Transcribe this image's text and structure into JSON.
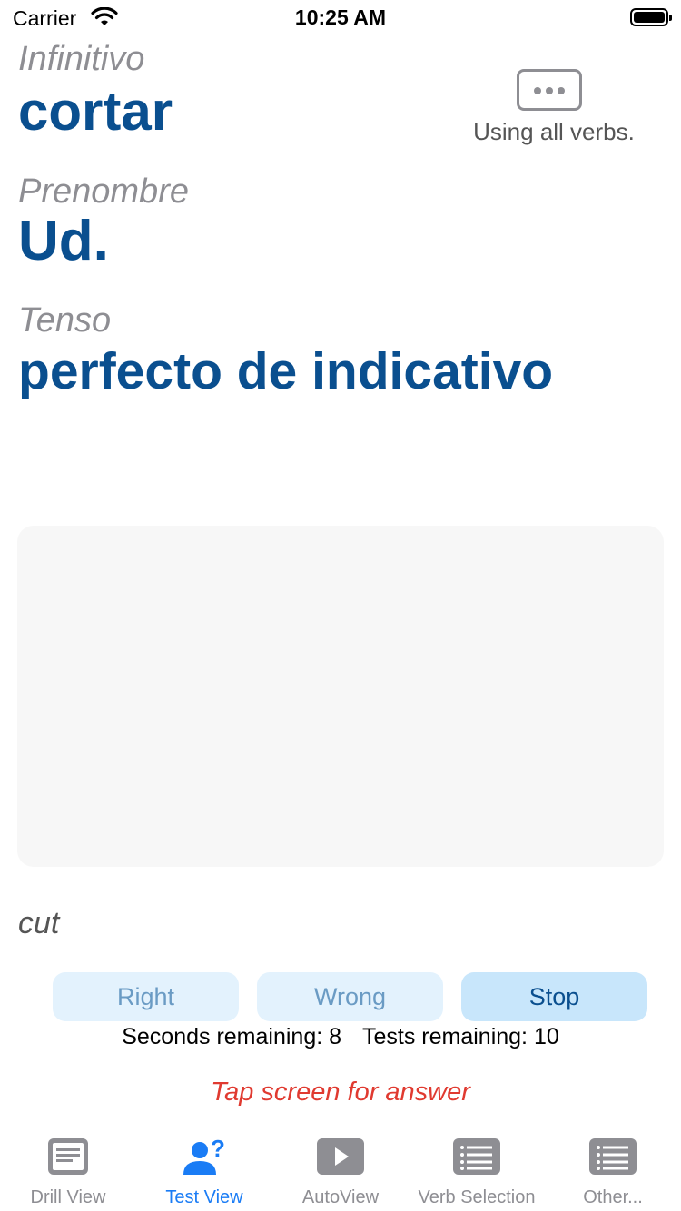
{
  "status_bar": {
    "carrier": "Carrier",
    "time": "10:25 AM"
  },
  "infinitive": {
    "label": "Infinitivo",
    "value": "cortar"
  },
  "pronoun": {
    "label": "Prenombre",
    "value": "Ud."
  },
  "tense": {
    "label": "Tenso",
    "value": "perfecto de indicativo"
  },
  "verb_filter": {
    "status": "Using all verbs."
  },
  "meaning": "cut",
  "buttons": {
    "right": "Right",
    "wrong": "Wrong",
    "stop": "Stop"
  },
  "counters": {
    "seconds": "Seconds remaining: 8",
    "tests": "Tests remaining: 10"
  },
  "hint": "Tap screen for answer",
  "tabs": [
    {
      "label": "Drill View",
      "icon": "document-icon"
    },
    {
      "label": "Test View",
      "icon": "person-question-icon"
    },
    {
      "label": "AutoView",
      "icon": "play-icon"
    },
    {
      "label": "Verb Selection",
      "icon": "list-icon"
    },
    {
      "label": "Other...",
      "icon": "list-icon"
    }
  ],
  "colors": {
    "accent": "#0a4f8f",
    "tab_active": "#1a7cf5",
    "hint": "#e03a30",
    "label_gray": "#8e8e93"
  }
}
